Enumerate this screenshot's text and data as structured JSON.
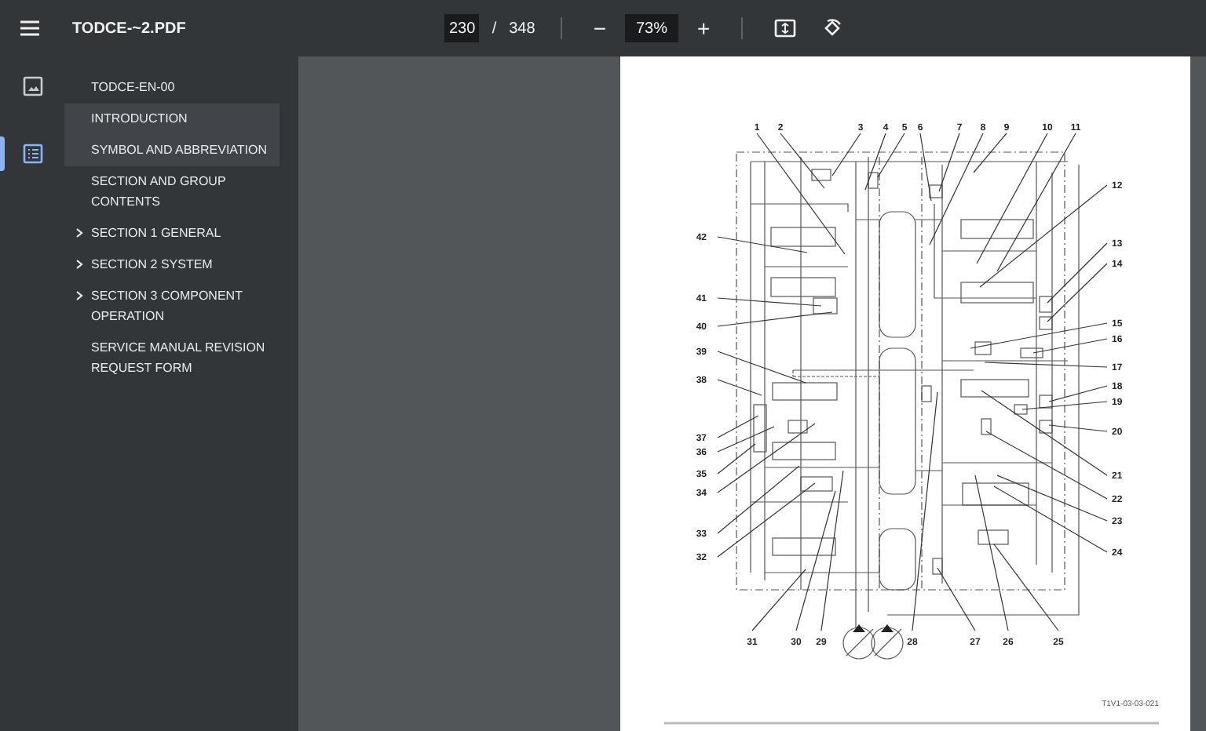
{
  "toolbar": {
    "title": "TODCE-~2.PDF",
    "page_input": "230",
    "page_separator": "/",
    "page_count": "348",
    "zoom_out": "−",
    "zoom_input": "73%",
    "zoom_in": "+"
  },
  "sidebar": {
    "tabs": [
      {
        "kind": "thumbnails",
        "selected": false
      },
      {
        "kind": "outline",
        "selected": true
      }
    ],
    "outline": [
      {
        "label": "TODCE-EN-00",
        "selected": false,
        "kind": "entry"
      },
      {
        "label": "INTRODUCTION",
        "selected": true,
        "kind": "entry"
      },
      {
        "label": "SYMBOL AND ABBREVIATION",
        "selected": true,
        "kind": "entry"
      },
      {
        "label": "SECTION AND GROUP CONTENTS",
        "selected": false,
        "kind": "entry"
      },
      {
        "label": "SECTION 1 GENERAL",
        "selected": false,
        "kind": "group"
      },
      {
        "label": "SECTION 2 SYSTEM",
        "selected": false,
        "kind": "group"
      },
      {
        "label": "SECTION 3 COMPONENT OPERATION",
        "selected": false,
        "kind": "group"
      },
      {
        "label": "SERVICE MANUAL REVISION REQUEST FORM",
        "selected": false,
        "kind": "entry"
      }
    ]
  },
  "page": {
    "figure_id": "T1V1-03-03-021",
    "callouts": [
      "1",
      "2",
      "3",
      "4",
      "5",
      "6",
      "7",
      "8",
      "9",
      "10",
      "11",
      "12",
      "13",
      "14",
      "15",
      "16",
      "17",
      "18",
      "19",
      "20",
      "21",
      "22",
      "23",
      "24",
      "31",
      "30",
      "29",
      "28",
      "27",
      "26",
      "25",
      "42",
      "41",
      "40",
      "39",
      "38",
      "37",
      "36",
      "35",
      "34",
      "33",
      "32"
    ]
  }
}
